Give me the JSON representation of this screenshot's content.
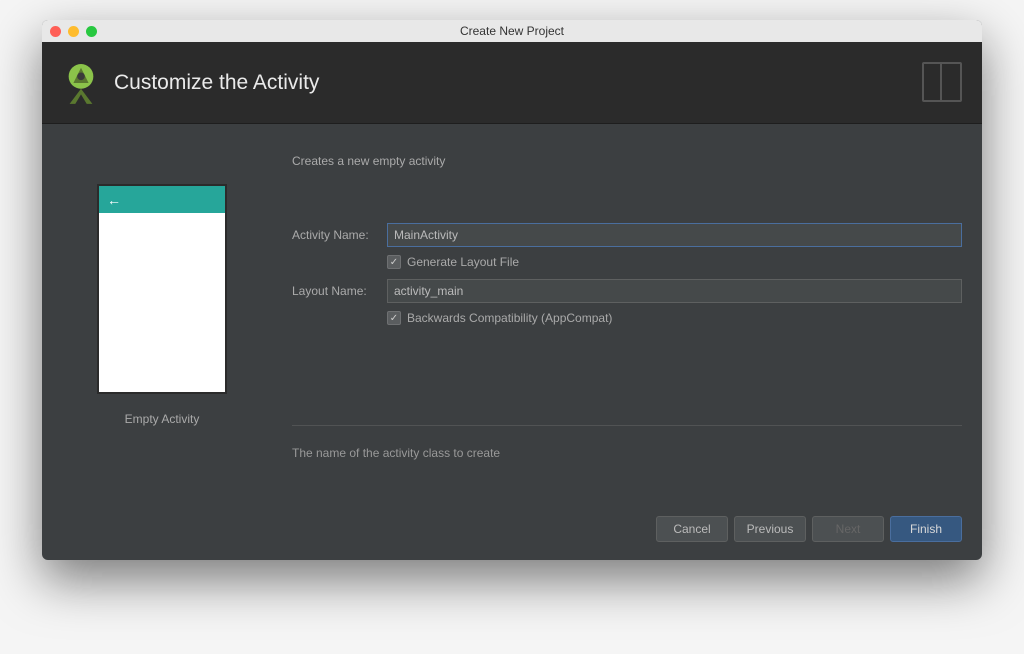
{
  "window": {
    "title": "Create New Project"
  },
  "header": {
    "title": "Customize the Activity"
  },
  "preview": {
    "label": "Empty Activity"
  },
  "form": {
    "subtitle": "Creates a new empty activity",
    "activity_name_label": "Activity Name:",
    "activity_name_value": "MainActivity",
    "generate_layout_label": "Generate Layout File",
    "generate_layout_checked": true,
    "layout_name_label": "Layout Name:",
    "layout_name_value": "activity_main",
    "backwards_compat_label": "Backwards Compatibility (AppCompat)",
    "backwards_compat_checked": true,
    "help_text": "The name of the activity class to create"
  },
  "buttons": {
    "cancel": "Cancel",
    "previous": "Previous",
    "next": "Next",
    "finish": "Finish"
  }
}
